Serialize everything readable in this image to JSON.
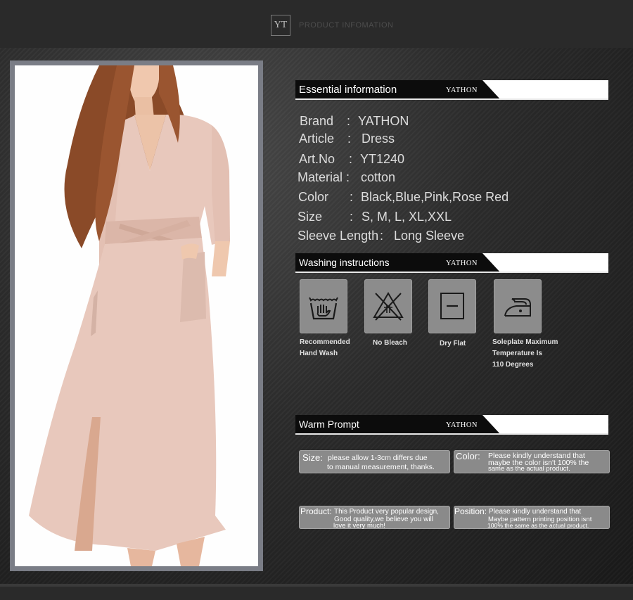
{
  "header": {
    "logo": "YT",
    "title": "PRODUCT INFOMATION"
  },
  "essential": {
    "title": "Essential information",
    "brand": "YATHON",
    "rows": [
      {
        "label": "Brand",
        "sep": ":",
        "value": "YATHON"
      },
      {
        "label": "Article",
        "sep": ":",
        "value": "Dress"
      },
      {
        "label": "Art.No",
        "sep": ":",
        "value": "YT1240"
      },
      {
        "label": "Material",
        "sep": ":",
        "value": "cotton"
      },
      {
        "label": "Color",
        "sep": ":",
        "value": "Black,Blue,Pink,Rose Red"
      },
      {
        "label": "Size",
        "sep": ":",
        "value": "S, M, L, XL,XXL"
      },
      {
        "label": "Sleeve Length",
        "sep": ":",
        "value": "Long Sleeve"
      }
    ]
  },
  "washing": {
    "title": "Washing instructions",
    "brand": "YATHON",
    "items": [
      {
        "icon": "hand-wash-icon",
        "line1": "Recommended",
        "line2": "Hand Wash",
        "line3": ""
      },
      {
        "icon": "no-bleach-icon",
        "line1": "No Bleach",
        "line2": "",
        "line3": ""
      },
      {
        "icon": "dry-flat-icon",
        "line1": "Dry Flat",
        "line2": "",
        "line3": ""
      },
      {
        "icon": "iron-icon",
        "line1": "Soleplate Maximum",
        "line2": "Temperature Is",
        "line3": "110 Degrees"
      }
    ]
  },
  "prompt": {
    "title": "Warm Prompt",
    "brand": "YATHON",
    "boxes": [
      {
        "key": "Size:",
        "line1": "please allow 1-3cm differs due",
        "line2": "to manual measurement, thanks.",
        "line3": ""
      },
      {
        "key": "Color:",
        "line1": "Please kindly understand that",
        "line2": "maybe the color isn't 100% the",
        "line3": "same as the actual product."
      },
      {
        "key": "Product:",
        "line1": "This Product very popular design,",
        "line2": "Good quality,we believe you will",
        "line3": "love it very much!"
      },
      {
        "key": "Position:",
        "line1": "Please kindly understand that",
        "line2": "Maybe pattern printing position isnt",
        "line3": "100% the same as the actual product."
      }
    ]
  },
  "colors": {
    "background": "#1d1d1d",
    "bar_black": "#0c0c0c",
    "card_gray": "#8c8c8c",
    "dress_pink": "#e8c8bc",
    "hair_brown": "#8a4a28"
  }
}
